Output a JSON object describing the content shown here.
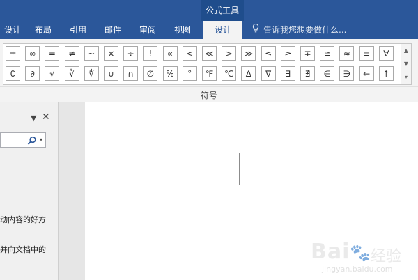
{
  "context_tab": "公式工具",
  "tabs": [
    {
      "label": "设计",
      "active": false
    },
    {
      "label": "布局",
      "active": false
    },
    {
      "label": "引用",
      "active": false
    },
    {
      "label": "邮件",
      "active": false
    },
    {
      "label": "审阅",
      "active": false
    },
    {
      "label": "视图",
      "active": false
    },
    {
      "label": "设计",
      "active": true
    }
  ],
  "tell_me": {
    "placeholder": "告诉我您想要做什么...",
    "icon": "lightbulb-icon"
  },
  "symbols": {
    "row1": [
      "±",
      "∞",
      "=",
      "≠",
      "~",
      "×",
      "÷",
      "!",
      "∝",
      "<",
      "≪",
      ">",
      "≫",
      "≤",
      "≥",
      "∓",
      "≅",
      "≈",
      "≡",
      "∀"
    ],
    "row2": [
      "∁",
      "∂",
      "√",
      "∛",
      "∜",
      "∪",
      "∩",
      "∅",
      "%",
      "°",
      "℉",
      "℃",
      "∆",
      "∇",
      "∃",
      "∄",
      "∈",
      "∋",
      "←",
      "↑"
    ]
  },
  "group_label": "符号",
  "panel": {
    "dropdown_icon": "▼",
    "close_icon": "✕",
    "search_icon": "search-icon",
    "text_line1": "动内容的好方",
    "text_line2": "并向文档中的"
  },
  "watermark": {
    "logo": "Baidu",
    "cn": "经验",
    "url": "jingyan.baidu.com"
  },
  "colors": {
    "ribbon_blue": "#2b579a",
    "context_blue": "#1f4d8c"
  }
}
